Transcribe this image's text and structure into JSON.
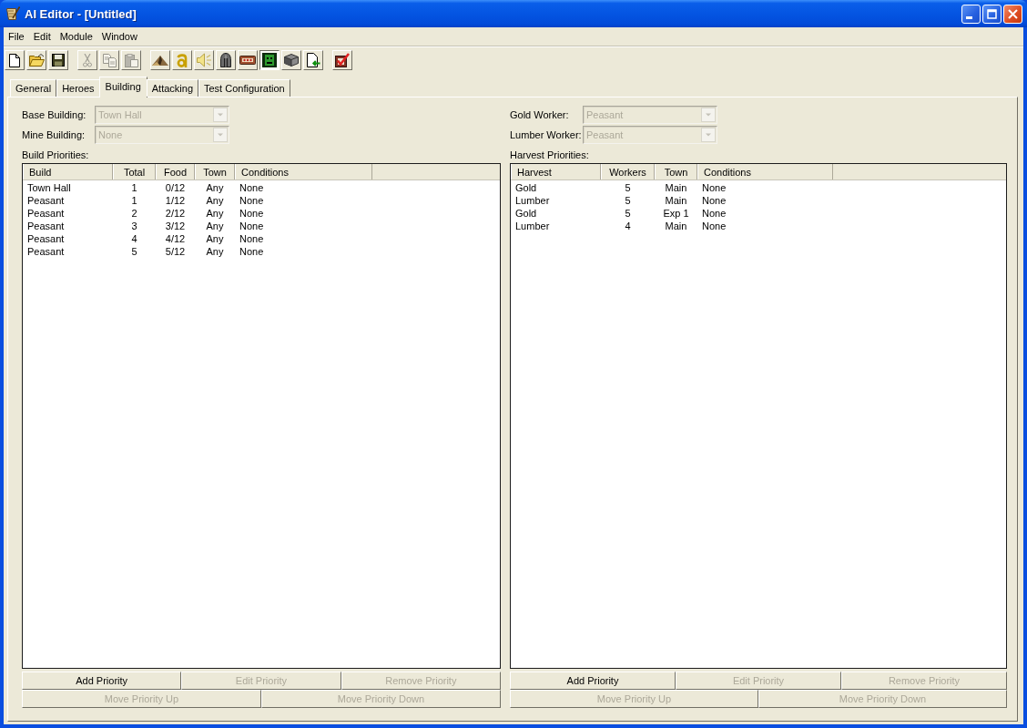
{
  "window": {
    "title": "AI Editor - [Untitled]"
  },
  "menu": [
    "File",
    "Edit",
    "Module",
    "Window"
  ],
  "toolbar": [
    {
      "buttons": [
        {
          "kind": "new",
          "disabled": false,
          "pressed": false
        },
        {
          "kind": "open",
          "disabled": false,
          "pressed": false
        },
        {
          "kind": "save",
          "disabled": false,
          "pressed": false
        }
      ]
    },
    {
      "buttons": [
        {
          "kind": "cut",
          "disabled": true,
          "pressed": false
        },
        {
          "kind": "copy",
          "disabled": true,
          "pressed": false
        },
        {
          "kind": "paste",
          "disabled": true,
          "pressed": false
        }
      ]
    },
    {
      "buttons": [
        {
          "kind": "terrain",
          "disabled": false,
          "pressed": false
        },
        {
          "kind": "ring",
          "disabled": false,
          "pressed": false
        },
        {
          "kind": "sound",
          "disabled": false,
          "pressed": false
        },
        {
          "kind": "helmet",
          "disabled": false,
          "pressed": false
        },
        {
          "kind": "chest",
          "disabled": false,
          "pressed": false
        },
        {
          "kind": "creature",
          "disabled": false,
          "pressed": true
        },
        {
          "kind": "cube",
          "disabled": false,
          "pressed": false
        },
        {
          "kind": "import",
          "disabled": false,
          "pressed": false
        }
      ]
    },
    {
      "buttons": [
        {
          "kind": "check",
          "disabled": false,
          "pressed": false
        }
      ]
    }
  ],
  "tabs": [
    {
      "label": "General",
      "selected": false
    },
    {
      "label": "Heroes",
      "selected": false
    },
    {
      "label": "Building",
      "selected": true
    },
    {
      "label": "Attacking",
      "selected": false
    },
    {
      "label": "Test Configuration",
      "selected": false
    }
  ],
  "panels": [
    {
      "fields": [
        {
          "label": "Base Building:",
          "value": "Town Hall",
          "disabled": true
        },
        {
          "label": "Mine Building:",
          "value": "None",
          "disabled": true
        }
      ],
      "list_label": "Build Priorities:",
      "columns": [
        "Build",
        "Total",
        "Food",
        "Town",
        "Conditions"
      ],
      "rows": [
        [
          "Town Hall",
          "1",
          "0/12",
          "Any",
          "None"
        ],
        [
          "Peasant",
          "1",
          "1/12",
          "Any",
          "None"
        ],
        [
          "Peasant",
          "2",
          "2/12",
          "Any",
          "None"
        ],
        [
          "Peasant",
          "3",
          "3/12",
          "Any",
          "None"
        ],
        [
          "Peasant",
          "4",
          "4/12",
          "Any",
          "None"
        ],
        [
          "Peasant",
          "5",
          "5/12",
          "Any",
          "None"
        ]
      ],
      "button_rows": [
        [
          {
            "label": "Add Priority",
            "disabled": false
          },
          {
            "label": "Edit Priority",
            "disabled": true
          },
          {
            "label": "Remove Priority",
            "disabled": true
          }
        ],
        [
          {
            "label": "Move Priority Up",
            "disabled": true
          },
          {
            "label": "Move Priority Down",
            "disabled": true
          }
        ]
      ]
    },
    {
      "fields": [
        {
          "label": "Gold Worker:",
          "value": "Peasant",
          "disabled": true
        },
        {
          "label": "Lumber Worker:",
          "value": "Peasant",
          "disabled": true
        }
      ],
      "list_label": "Harvest Priorities:",
      "columns": [
        "Harvest",
        "Workers",
        "Town",
        "Conditions"
      ],
      "rows": [
        [
          "Gold",
          "5",
          "Main",
          "None"
        ],
        [
          "Lumber",
          "5",
          "Main",
          "None"
        ],
        [
          "Gold",
          "5",
          "Exp 1",
          "None"
        ],
        [
          "Lumber",
          "4",
          "Main",
          "None"
        ]
      ],
      "button_rows": [
        [
          {
            "label": "Add Priority",
            "disabled": false
          },
          {
            "label": "Edit Priority",
            "disabled": true
          },
          {
            "label": "Remove Priority",
            "disabled": true
          }
        ],
        [
          {
            "label": "Move Priority Up",
            "disabled": true
          },
          {
            "label": "Move Priority Down",
            "disabled": true
          }
        ]
      ]
    }
  ]
}
